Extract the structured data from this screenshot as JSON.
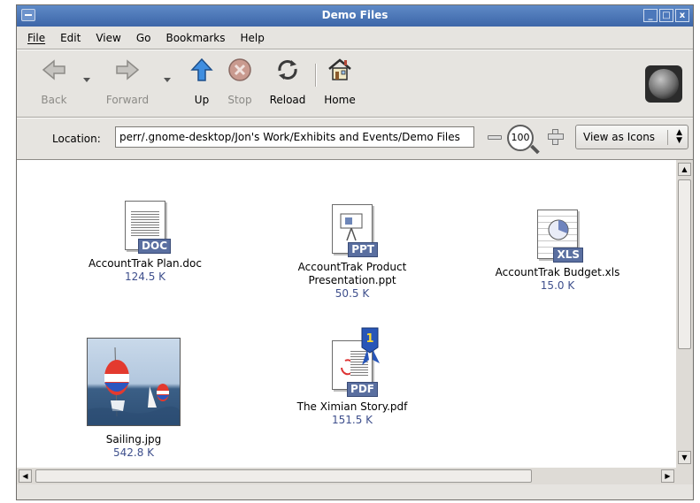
{
  "window": {
    "title": "Demo Files",
    "buttons": {
      "minimize": "_",
      "maximize": "□",
      "close": "x"
    }
  },
  "menubar": {
    "items": [
      {
        "label": "File"
      },
      {
        "label": "Edit"
      },
      {
        "label": "View"
      },
      {
        "label": "Go"
      },
      {
        "label": "Bookmarks"
      },
      {
        "label": "Help"
      }
    ]
  },
  "toolbar": {
    "back": {
      "label": "Back",
      "icon": "arrow-left-icon",
      "enabled": false
    },
    "forward": {
      "label": "Forward",
      "icon": "arrow-right-icon",
      "enabled": false
    },
    "up": {
      "label": "Up",
      "icon": "arrow-up-icon",
      "enabled": true
    },
    "stop": {
      "label": "Stop",
      "icon": "stop-icon",
      "enabled": false
    },
    "reload": {
      "label": "Reload",
      "icon": "reload-icon",
      "enabled": true
    },
    "home": {
      "label": "Home",
      "icon": "home-icon",
      "enabled": true
    }
  },
  "location": {
    "label": "Location:",
    "value": "perr/.gnome-desktop/Jon's Work/Exhibits and Events/Demo Files",
    "zoom_level": "100",
    "view_mode": "View as Icons"
  },
  "files": [
    {
      "name": "AccountTrak Plan.doc",
      "size": "124.5 K",
      "type": "DOC"
    },
    {
      "name": "AccountTrak Product Presentation.ppt",
      "size": "50.5 K",
      "type": "PPT"
    },
    {
      "name": "AccountTrak Budget.xls",
      "size": "15.0 K",
      "type": "XLS"
    },
    {
      "name": "Sailing.jpg",
      "size": "542.8 K",
      "type": "JPG"
    },
    {
      "name": "The Ximian Story.pdf",
      "size": "151.5 K",
      "type": "PDF",
      "emblem": "1"
    }
  ],
  "colors": {
    "titlebar": "#4a75b6",
    "window_bg": "#e6e4e0",
    "size_text": "#3e4f8c",
    "doc_badge": "#5a6fa0"
  }
}
